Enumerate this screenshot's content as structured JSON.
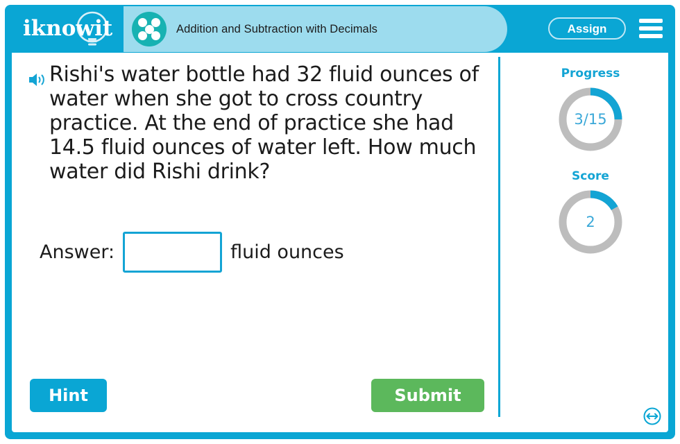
{
  "brand": {
    "logo_text": "iknowit",
    "logo_icon": "lightbulb-icon"
  },
  "header": {
    "lesson_title": "Addition and Subtraction with Decimals",
    "badge_icon": "five-dots-circle-icon",
    "assign_label": "Assign",
    "menu_icon": "hamburger-menu-icon"
  },
  "question": {
    "speaker_icon": "speaker-audio-icon",
    "text": "Rishi's water bottle had 32 fluid ounces of water when she got to cross country practice. At the end of practice she had 14.5 fluid ounces of water left. How much water did Rishi drink?"
  },
  "answer": {
    "label": "Answer:",
    "value": "",
    "placeholder": "",
    "unit": "fluid ounces"
  },
  "actions": {
    "hint_label": "Hint",
    "submit_label": "Submit",
    "resize_icon": "resize-horizontal-icon"
  },
  "stats": {
    "progress": {
      "label": "Progress",
      "value": "3/15",
      "current": 3,
      "total": 15,
      "percent": 20
    },
    "score": {
      "label": "Score",
      "value": "2",
      "current": 2,
      "percent": 13
    }
  },
  "colors": {
    "brand_cyan": "#0aa6d4",
    "badge_light_blue": "#9ddcee",
    "badge_teal": "#17b2b2",
    "submit_green": "#5cb85c",
    "ring_track_gray": "#bdbdbd",
    "ring_fill_cyan": "#13a4d4"
  }
}
